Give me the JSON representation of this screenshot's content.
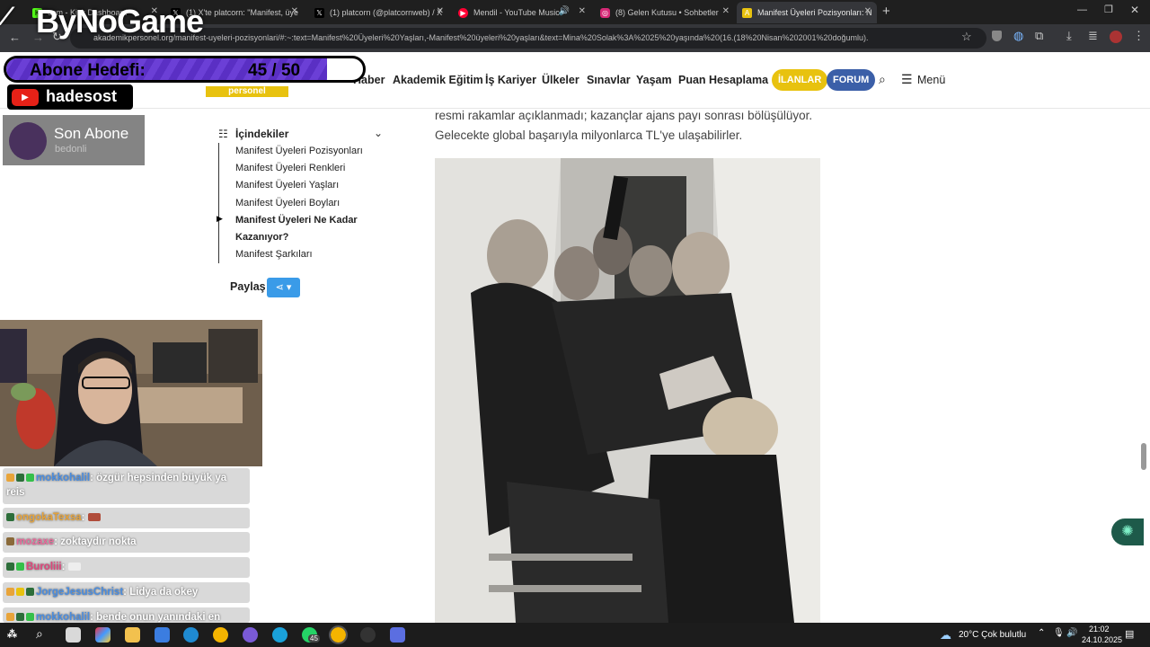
{
  "browser": {
    "tabs": [
      {
        "label": "com - Kick Dashboard",
        "color": "#53fc18",
        "icon": "kick-icon"
      },
      {
        "label": "(1) X'te platcorn: \"Manifest, üye",
        "color": "#000000",
        "icon": "x-icon"
      },
      {
        "label": "(1) platcorn (@platcornweb) / X",
        "color": "#000000",
        "icon": "x-icon"
      },
      {
        "label": "Mendil - YouTube Music",
        "color": "#ff0033",
        "icon": "youtube-music-icon"
      },
      {
        "label": "(8) Gelen Kutusu • Sohbetler",
        "color": "#d62976",
        "icon": "instagram-icon"
      },
      {
        "label": "Manifest Üyeleri Pozisyonları: N",
        "color": "#e8c20f",
        "icon": "site-favicon"
      }
    ],
    "url": "akademikpersonel.org/manifest-uyeleri-pozisyonlari/#:~:text=Manifest%20Üyeleri%20Yaşları,-Manifest%20üyeleri%20yaşları&text=Mina%20Solak%3A%2025%20yaşında%20(16.(18%20Nisan%202001%20doğumlu)."
  },
  "site": {
    "logo_sub": "personel",
    "nav": [
      "Haber",
      "Akademik Eğitim",
      "İş Kariyer",
      "Ülkeler",
      "Sınavlar",
      "Yaşam",
      "Puan Hesaplama"
    ],
    "ilanlar": "İLANLAR",
    "forum": "FORUM",
    "menu": "Menü",
    "colors": {
      "ilanlar": "#e8c20f",
      "forum": "#3b5fa8"
    }
  },
  "toc": {
    "title": "İçindekiler",
    "items": [
      "Manifest Üyeleri Pozisyonları",
      "Manifest Üyeleri Renkleri",
      "Manifest Üyeleri Yaşları",
      "Manifest Üyeleri Boyları",
      "Manifest Üyeleri Ne Kadar",
      "Kazanıyor?",
      "Manifest Şarkıları"
    ],
    "share": "Paylaş"
  },
  "article": {
    "line1": "resmi rakamlar açıklanmadı; kazançlar ajans payı sonrası bölüşülüyor.",
    "line2": "Gelecekte global başarıyla milyonlarca TL'ye ulaşabilirler."
  },
  "overlay": {
    "brand": "ByNoGame",
    "goal_label": "Abone Hedefi:",
    "goal_value": "45 / 50",
    "goal_progress": 0.9,
    "channel": "hadesost",
    "last_sub_label": "Son Abone",
    "last_sub_name": "bedonli"
  },
  "chat": [
    {
      "user": "mokkohalil",
      "msg": "özgür hepsinden büyük ya reis",
      "color": "#4a8de0"
    },
    {
      "user": "ongokaTexsa",
      "msg": "",
      "color": "#e8a43a"
    },
    {
      "user": "mozaxe",
      "msg": "zoktaydır nokta",
      "color": "#e86a9a"
    },
    {
      "user": "Buroliii",
      "msg": "",
      "color": "#e0457b"
    },
    {
      "user": "JorgeJesusChrist",
      "msg": "Lidya da okey",
      "color": "#4a8de0"
    },
    {
      "user": "mokkohalil",
      "msg": "bende onun yanındaki en",
      "color": "#4a8de0"
    }
  ],
  "taskbar": {
    "weather": "20°C  Çok bulutlu",
    "time": "21:02",
    "date": "24.10.2025",
    "whatsapp_badge": "45"
  }
}
